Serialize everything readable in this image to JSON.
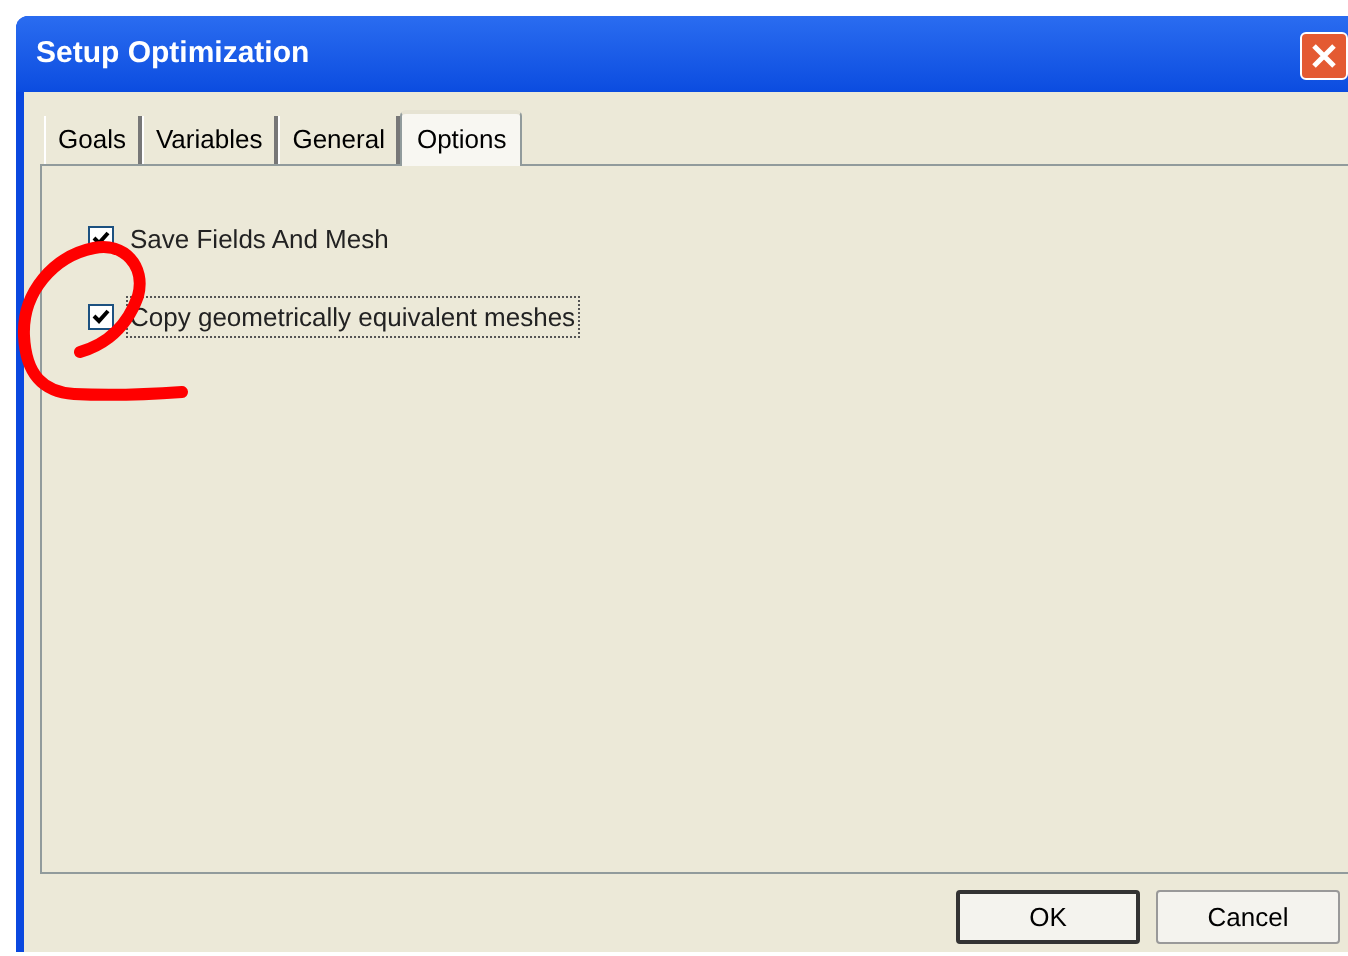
{
  "window": {
    "title": "Setup Optimization"
  },
  "tabs": [
    {
      "label": "Goals",
      "selected": false
    },
    {
      "label": "Variables",
      "selected": false
    },
    {
      "label": "General",
      "selected": false
    },
    {
      "label": "Options",
      "selected": true
    }
  ],
  "options": [
    {
      "label": "Save Fields And Mesh",
      "checked": true,
      "focused": false
    },
    {
      "label": "Copy geometrically equivalent meshes",
      "checked": true,
      "focused": true
    }
  ],
  "buttons": [
    {
      "label": "OK",
      "default": true
    },
    {
      "label": "Cancel",
      "default": false
    }
  ]
}
